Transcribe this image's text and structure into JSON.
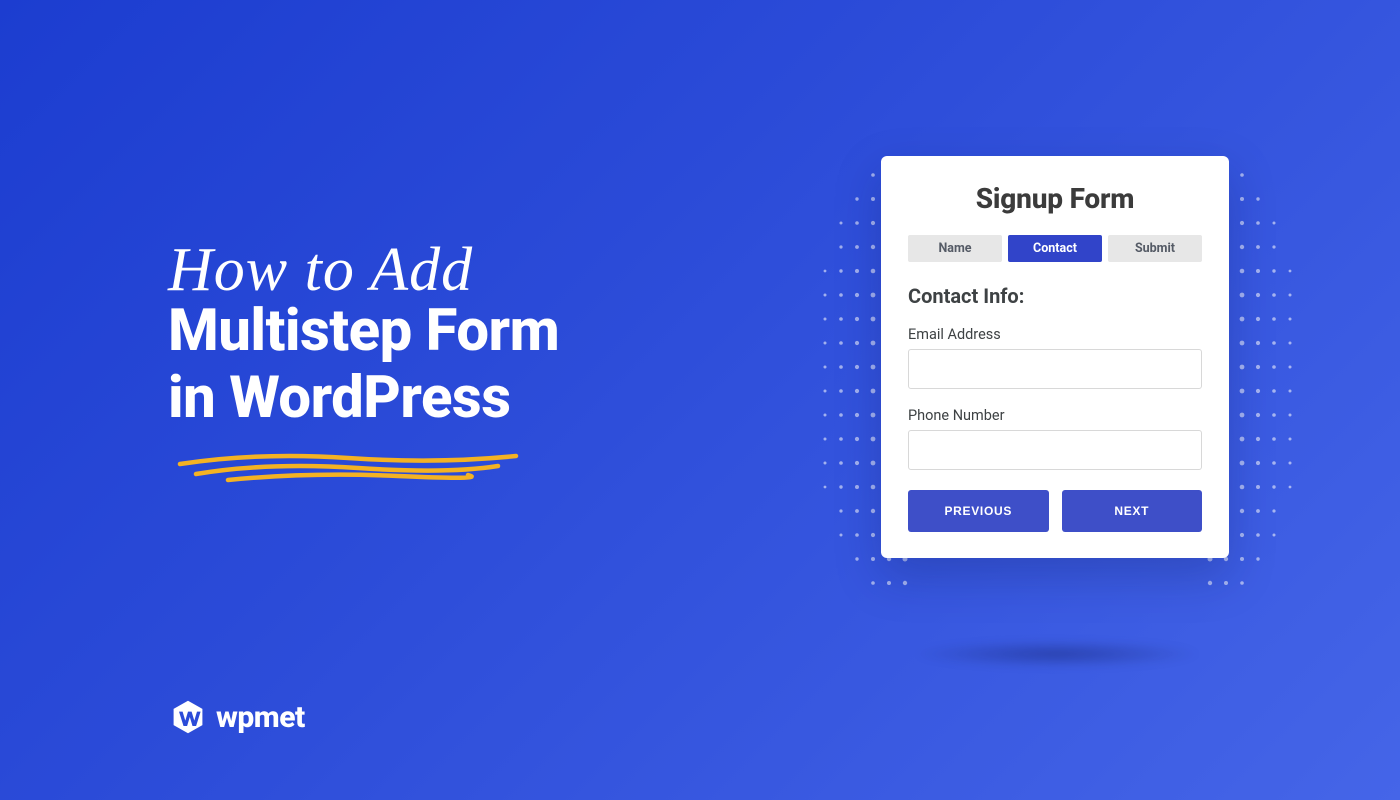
{
  "headline": {
    "script": "How to Add",
    "line1": "Multistep Form",
    "line2": "in WordPress"
  },
  "brand": {
    "name": "wpmet"
  },
  "form": {
    "title": "Signup Form",
    "tabs": [
      {
        "label": "Name",
        "active": false
      },
      {
        "label": "Contact",
        "active": true
      },
      {
        "label": "Submit",
        "active": false
      }
    ],
    "section_heading": "Contact Info:",
    "fields": {
      "email": {
        "label": "Email Address",
        "value": ""
      },
      "phone": {
        "label": "Phone Number",
        "value": ""
      }
    },
    "buttons": {
      "prev": "PREVIOUS",
      "next": "NEXT"
    }
  },
  "colors": {
    "accent": "#3144c9",
    "button": "#3e4fc8",
    "highlight": "#f4b223"
  }
}
